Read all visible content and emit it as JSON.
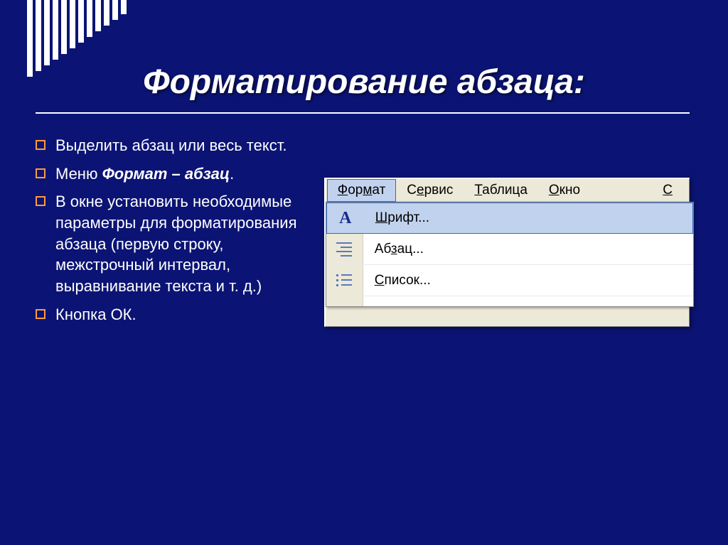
{
  "title": "Форматирование абзаца:",
  "bullets": {
    "b0": "Выделить абзац или весь текст.",
    "b1_pre": "Меню ",
    "b1_bold": "Формат – абзац",
    "b1_post": ".",
    "b2": "В окне установить необходимые параметры для форматирования абзаца (первую строку, межстрочный интервал, выравнивание текста и т. д.)",
    "b3": "Кнопка ОК."
  },
  "menuBar": {
    "format": "Формат",
    "service": "Сервис",
    "table": "Таблица",
    "window": "Окно",
    "last": "С"
  },
  "dropdown": {
    "font": "Шрифт...",
    "paragraph": "Абзац...",
    "list": "Список..."
  }
}
